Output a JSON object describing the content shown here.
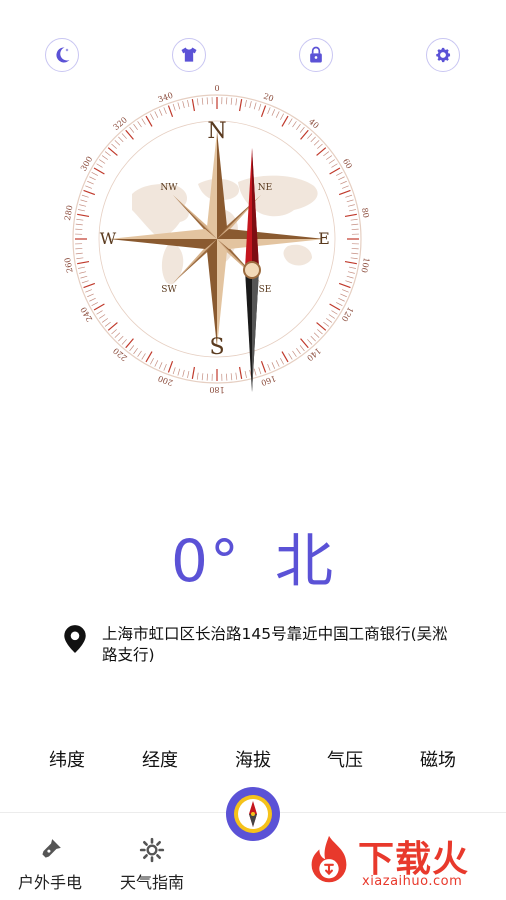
{
  "compass": {
    "cardinals": {
      "n": "N",
      "e": "E",
      "s": "S",
      "w": "W"
    },
    "intercardinals": {
      "ne": "NE",
      "nw": "NW",
      "se": "SE",
      "sw": "SW"
    },
    "degree_labels": [
      "0",
      "20",
      "40",
      "60",
      "80",
      "100",
      "120",
      "140",
      "160",
      "180",
      "200",
      "220",
      "240",
      "260",
      "280",
      "300",
      "320",
      "340"
    ]
  },
  "heading": {
    "degrees": "0°",
    "direction": "北"
  },
  "location": {
    "address": "上海市虹口区长治路145号靠近中国工商银行(吴淞路支行)"
  },
  "metrics": [
    {
      "label": "纬度"
    },
    {
      "label": "经度"
    },
    {
      "label": "海拔"
    },
    {
      "label": "气压"
    },
    {
      "label": "磁场"
    }
  ],
  "nav": {
    "left1": {
      "label": "户外手电",
      "icon": "flashlight-icon"
    },
    "left2": {
      "label": "天气指南",
      "icon": "gear-icon"
    },
    "center": {
      "icon": "compass-icon"
    }
  },
  "watermark": {
    "title": "下载火",
    "url": "xiazaihuo.com"
  },
  "colors": {
    "accent": "#5b52d6",
    "compass_tick": "#c0392b",
    "needle_red": "#b8161e",
    "rose_tan": "#c49a6c",
    "watermark_red": "#e8392c"
  }
}
